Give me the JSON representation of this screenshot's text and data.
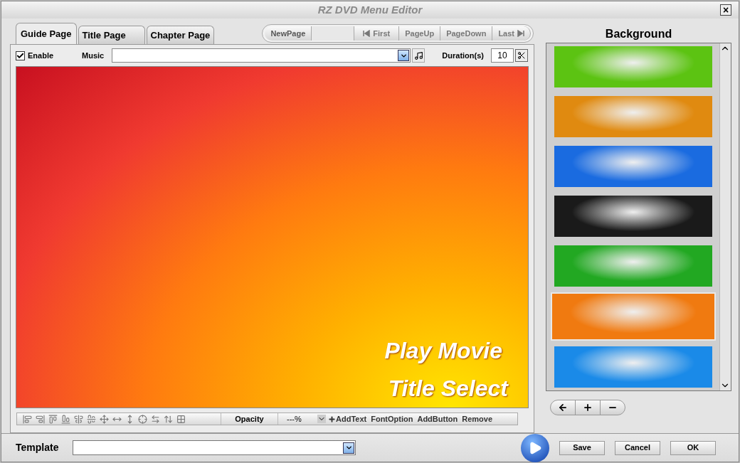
{
  "window": {
    "title": "RZ DVD Menu Editor",
    "close": "×"
  },
  "tabs": [
    {
      "label": "Guide Page",
      "selected": true
    },
    {
      "label": "Title Page",
      "selected": false
    },
    {
      "label": "Chapter Page",
      "selected": false
    }
  ],
  "pager": {
    "new_page": "NewPage",
    "buttons": [
      "First",
      "PageUp",
      "PageDown",
      "Last"
    ]
  },
  "options": {
    "enable": {
      "label": "Enable",
      "checked": true
    },
    "music_label": "Music",
    "duration_label": "Duration(s)",
    "duration": "10"
  },
  "canvas": {
    "texts": [
      "Play Movie",
      "Title Select"
    ]
  },
  "toolbar": {
    "opacity_label": "Opacity",
    "opacity": "---%",
    "actions": [
      "AddText",
      "FontOption",
      "AddButton",
      "Remove"
    ]
  },
  "template": {
    "label": "Template"
  },
  "background": {
    "title": "Background",
    "thumbnails": [
      {
        "color": "#5cc312",
        "selected": false
      },
      {
        "color": "#e08a10",
        "selected": false
      },
      {
        "color": "#1a6be0",
        "selected": false
      },
      {
        "color": "#1a1a1a",
        "selected": false
      },
      {
        "color": "#22a822",
        "selected": false
      },
      {
        "color": "#f07a10",
        "selected": true
      },
      {
        "color": "#1a8ae8",
        "selected": false
      }
    ]
  },
  "footer": {
    "buttons": [
      "Save",
      "Cancel",
      "OK"
    ]
  }
}
